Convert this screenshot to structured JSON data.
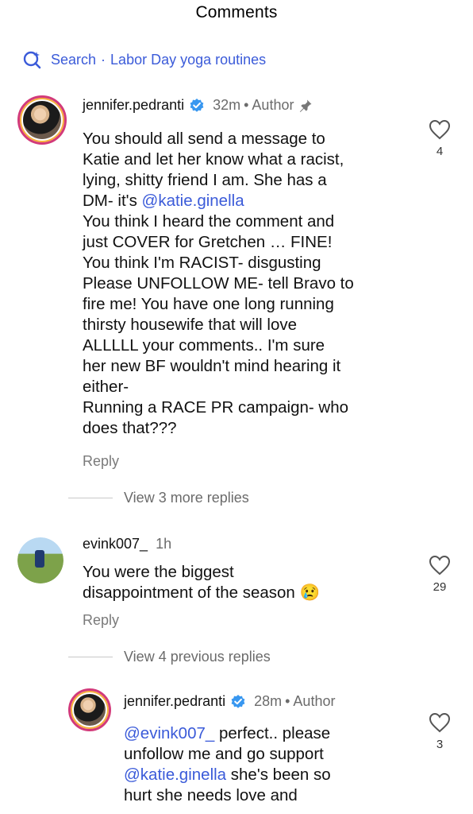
{
  "header": {
    "title": "Comments"
  },
  "search": {
    "label": "Search",
    "separator": "·",
    "query": "Labor Day yoga routines"
  },
  "comments": [
    {
      "username": "jennifer.pedranti",
      "time": "32m",
      "author_label": "Author",
      "lines": [
        "You should all send a message to",
        "Katie and let her know what a racist,",
        "lying, shitty friend I am. She has a",
        "DM- it's ",
        "You think I heard the comment and",
        "just COVER for Gretchen … FINE!",
        "You think I'm RACIST- disgusting",
        "Please UNFOLLOW ME- tell Bravo to",
        "fire me! You have one long running",
        "thirsty housewife that will love",
        "ALLLLL your comments.. I'm sure",
        "her new BF wouldn't mind hearing it",
        "either-",
        "Running a RACE PR campaign- who",
        "does that???"
      ],
      "mention": "@katie.ginella",
      "likes": "4",
      "reply_label": "Reply",
      "view_replies": "View 3 more replies"
    },
    {
      "username": "evink007_",
      "time": "1h",
      "lines": [
        "You were the biggest",
        "disappointment of the season"
      ],
      "emoji": "😢",
      "likes": "29",
      "reply_label": "Reply",
      "view_replies": "View 4 previous replies"
    },
    {
      "username": "jennifer.pedranti",
      "time": "28m",
      "author_label": "Author",
      "mention1": "@evink007_",
      "line1_rest": " perfect.. please",
      "line2": "unfollow me and go support",
      "mention2": "@katie.ginella",
      "line3_rest": " she's been so",
      "line4": "hurt she needs love and",
      "likes": "3"
    }
  ],
  "icons": {
    "search": "search-sparkle-icon",
    "verified": "verified-badge-icon",
    "pin": "pin-icon",
    "heart": "heart-outline-icon"
  },
  "colors": {
    "link": "#3b5bd9",
    "verified": "#3897f0",
    "muted": "#6b6b6b"
  }
}
